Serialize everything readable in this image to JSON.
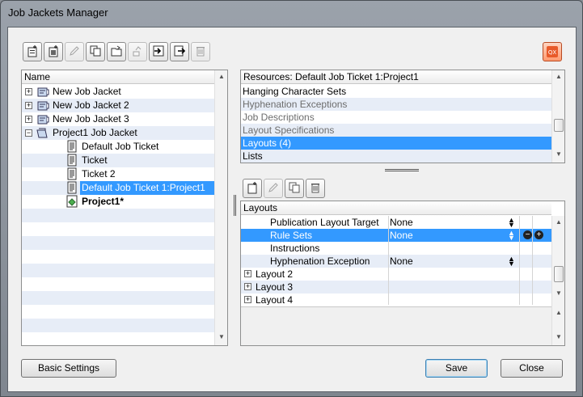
{
  "window": {
    "title": "Job Jackets Manager"
  },
  "toolbar_top": [
    {
      "name": "new-job-jacket-icon",
      "disabled": false
    },
    {
      "name": "new-job-ticket-icon",
      "disabled": false
    },
    {
      "name": "edit-icon",
      "disabled": true
    },
    {
      "name": "duplicate-icon",
      "disabled": false
    },
    {
      "name": "open-icon",
      "disabled": false
    },
    {
      "name": "link-icon",
      "disabled": true
    },
    {
      "name": "import-icon",
      "disabled": false
    },
    {
      "name": "export-icon",
      "disabled": false
    },
    {
      "name": "delete-icon",
      "disabled": true
    }
  ],
  "tree": {
    "header": "Name",
    "items": [
      {
        "label": "New Job Jacket",
        "expander": "+",
        "icon": "jacket",
        "level": 0
      },
      {
        "label": "New Job Jacket 2",
        "expander": "+",
        "icon": "jacket",
        "level": 0
      },
      {
        "label": "New Job Jacket 3",
        "expander": "+",
        "icon": "jacket",
        "level": 0
      },
      {
        "label": "Project1 Job Jacket",
        "expander": "−",
        "icon": "jacket-open",
        "level": 0
      },
      {
        "label": "Default Job Ticket",
        "expander": "",
        "icon": "ticket",
        "level": 1
      },
      {
        "label": "Ticket",
        "expander": "",
        "icon": "ticket",
        "level": 1
      },
      {
        "label": "Ticket 2",
        "expander": "",
        "icon": "ticket",
        "level": 1
      },
      {
        "label": "Default Job Ticket 1:Project1",
        "expander": "",
        "icon": "ticket",
        "level": 1,
        "selected": true
      },
      {
        "label": "Project1*",
        "expander": "",
        "icon": "project",
        "level": 1,
        "bold": true
      }
    ]
  },
  "resources": {
    "header": "Resources: Default Job Ticket 1:Project1",
    "items": [
      {
        "label": "Hanging Character Sets",
        "dim": false
      },
      {
        "label": "Hyphenation Exceptions",
        "dim": true
      },
      {
        "label": "Job Descriptions",
        "dim": true
      },
      {
        "label": "Layout Specifications",
        "dim": true
      },
      {
        "label": "Layouts (4)",
        "dim": false,
        "selected": true
      },
      {
        "label": "Lists",
        "dim": false
      }
    ]
  },
  "toolbar_layouts": [
    {
      "name": "new-layout-icon",
      "disabled": false
    },
    {
      "name": "edit-layout-icon",
      "disabled": true
    },
    {
      "name": "duplicate-layout-icon",
      "disabled": false
    },
    {
      "name": "delete-layout-icon",
      "disabled": false
    }
  ],
  "layouts": {
    "header": "Layouts",
    "rows": [
      {
        "label": "Publication Layout Target",
        "value": "None",
        "select": true,
        "indent": true
      },
      {
        "label": "Rule Sets",
        "value": "None",
        "select": true,
        "indent": true,
        "selected": true,
        "minusplus": true
      },
      {
        "label": "Instructions",
        "value": "",
        "select": false,
        "indent": true
      },
      {
        "label": "Hyphenation Exception",
        "value": "None",
        "select": true,
        "indent": true
      },
      {
        "label": "Layout 2",
        "value": "",
        "expander": "+"
      },
      {
        "label": "Layout 3",
        "value": "",
        "expander": "+"
      },
      {
        "label": "Layout 4",
        "value": "",
        "expander": "+"
      }
    ]
  },
  "buttons": {
    "basic_settings": "Basic Settings",
    "save": "Save",
    "close": "Close"
  },
  "colors": {
    "selection": "#3399ff",
    "stripe": "#e7edf7",
    "help_icon": "#e85a2a"
  }
}
